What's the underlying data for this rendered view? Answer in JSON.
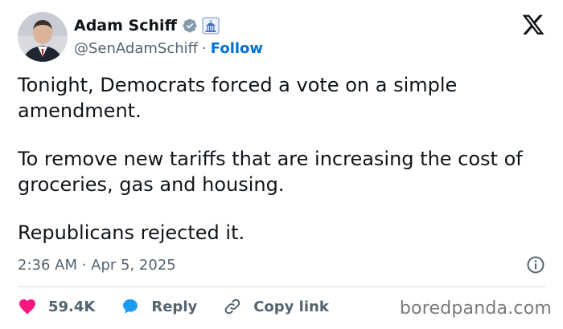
{
  "author": {
    "display_name": "Adam Schiff",
    "handle": "@SenAdamSchiff",
    "separator": "·",
    "follow_label": "Follow",
    "verified_icon": "verified-badge-icon",
    "affiliation_icon": "government-building-icon"
  },
  "tweet": {
    "paragraphs": [
      "Tonight, Democrats forced a vote on a simple amendment.",
      "To remove new tariffs that are increasing the cost of groceries, gas and housing.",
      "Republicans rejected it."
    ],
    "timestamp": "2:36 AM · Apr 5, 2025"
  },
  "actions": {
    "likes": "59.4K",
    "reply_label": "Reply",
    "copy_link_label": "Copy link"
  },
  "watermark": "boredpanda.com",
  "colors": {
    "text": "#0f1419",
    "muted": "#536471",
    "link": "#006fd6",
    "heart": "#f91880",
    "reply": "#1d9bf0",
    "verified": "#829aab",
    "divider": "#cfd9de"
  }
}
